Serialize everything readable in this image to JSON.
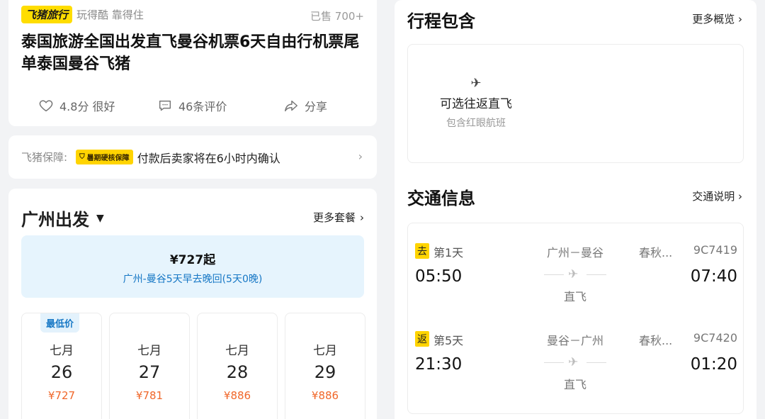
{
  "product": {
    "brand": "飞猪旅行",
    "slogan": "玩得酷 靠得住",
    "sold": "已售 700+",
    "title": "泰国旅游全国出发直飞曼谷机票6天自由行机票尾单泰国曼谷飞猪",
    "rating": "4.8分 很好",
    "reviews": "46条评价",
    "share": "分享"
  },
  "guarantee": {
    "label": "飞猪保障:",
    "badge": "暑期硬核保障",
    "text": "付款后卖家将在6小时内确认"
  },
  "departure": {
    "city": "广州出发",
    "more": "更多套餐",
    "package": {
      "price": "¥727起",
      "desc": "广州-曼谷5天早去晚回(5天0晚)"
    },
    "lowest_label": "最低价",
    "dates": [
      {
        "month": "七月",
        "day": "26",
        "price": "¥727"
      },
      {
        "month": "七月",
        "day": "27",
        "price": "¥781"
      },
      {
        "month": "七月",
        "day": "28",
        "price": "¥886"
      },
      {
        "month": "七月",
        "day": "29",
        "price": "¥886"
      }
    ]
  },
  "itinerary": {
    "title": "行程包含",
    "more": "更多概览",
    "item_main": "可选往返直飞",
    "item_sub": "包含红眼航班"
  },
  "transport": {
    "title": "交通信息",
    "link": "交通说明",
    "legs": [
      {
        "tag": "去",
        "day": "第1天",
        "dep": "05:50",
        "route": "广州－曼谷",
        "type": "直飞",
        "airline": "春秋...",
        "flight": "9C7419",
        "arr": "07:40"
      },
      {
        "tag": "返",
        "day": "第5天",
        "dep": "21:30",
        "route": "曼谷－广州",
        "type": "直飞",
        "airline": "春秋...",
        "flight": "9C7420",
        "arr": "01:20"
      }
    ]
  }
}
